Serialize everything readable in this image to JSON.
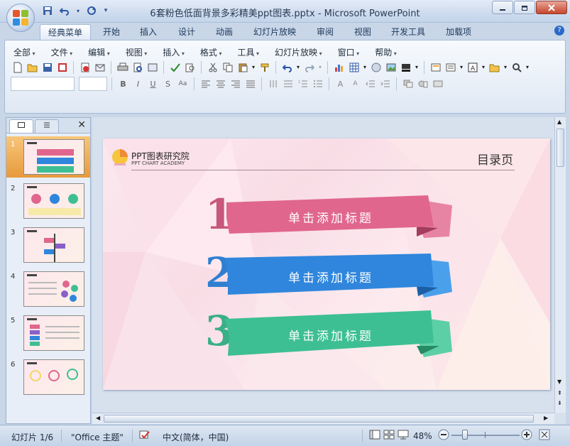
{
  "window": {
    "title": "6套粉色低面背景多彩精美ppt图表.pptx - Microsoft PowerPoint"
  },
  "ribbon_tabs": [
    "经典菜单",
    "开始",
    "插入",
    "设计",
    "动画",
    "幻灯片放映",
    "审阅",
    "视图",
    "开发工具",
    "加载项"
  ],
  "classic_menu": [
    "全部",
    "文件",
    "编辑",
    "视图",
    "插入",
    "格式",
    "工具",
    "幻灯片放映",
    "窗口",
    "帮助"
  ],
  "slide": {
    "logo_title": "PPT图表研究院",
    "logo_subtitle": "PPT CHART ACADEMY",
    "page_heading": "目录页",
    "items": [
      {
        "number": "1",
        "label": "单击添加标题",
        "color": "#e0668e"
      },
      {
        "number": "2",
        "label": "单击添加标题",
        "color": "#2f86dc"
      },
      {
        "number": "3",
        "label": "单击添加标题",
        "color": "#3dbf93"
      }
    ]
  },
  "thumbnails": [
    "1",
    "2",
    "3",
    "4",
    "5",
    "6"
  ],
  "status": {
    "slide_info": "幻灯片 1/6",
    "theme": "\"Office 主题\"",
    "language": "中文(简体，中国)",
    "zoom": "48%"
  }
}
